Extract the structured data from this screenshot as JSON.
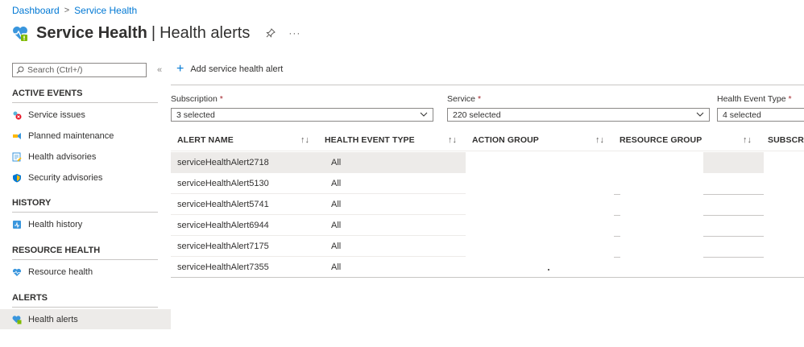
{
  "breadcrumb": {
    "items": [
      "Dashboard",
      "Service Health"
    ],
    "separator": ">"
  },
  "header": {
    "title": "Service Health",
    "divider": "|",
    "subtitle": "Health alerts",
    "more": "···"
  },
  "search": {
    "placeholder": "Search (Ctrl+/)"
  },
  "collapse_glyph": "«",
  "sidebar": {
    "sections": [
      {
        "heading": "ACTIVE EVENTS",
        "items": [
          {
            "label": "Service issues",
            "icon": "service-issues-icon"
          },
          {
            "label": "Planned maintenance",
            "icon": "planned-maintenance-icon"
          },
          {
            "label": "Health advisories",
            "icon": "health-advisories-icon"
          },
          {
            "label": "Security advisories",
            "icon": "security-advisories-icon"
          }
        ]
      },
      {
        "heading": "HISTORY",
        "items": [
          {
            "label": "Health history",
            "icon": "health-history-icon"
          }
        ]
      },
      {
        "heading": "RESOURCE HEALTH",
        "items": [
          {
            "label": "Resource health",
            "icon": "heart-icon"
          }
        ]
      },
      {
        "heading": "ALERTS",
        "items": [
          {
            "label": "Health alerts",
            "icon": "health-alerts-icon",
            "active": true
          }
        ]
      }
    ]
  },
  "toolbar": {
    "add_label": "Add service health alert"
  },
  "filters": {
    "subscription": {
      "label": "Subscription",
      "required": "*",
      "value": "3 selected"
    },
    "service": {
      "label": "Service",
      "required": "*",
      "value": "220 selected"
    },
    "event_type": {
      "label": "Health Event Type",
      "required": "*",
      "value": "4 selected"
    }
  },
  "table": {
    "columns": [
      "ALERT NAME",
      "HEALTH EVENT TYPE",
      "ACTION GROUP",
      "RESOURCE GROUP",
      "SUBSCRIP"
    ],
    "sort_glyph": "↑↓",
    "rows": [
      {
        "name": "serviceHealthAlert2718",
        "type": "All",
        "selected": true
      },
      {
        "name": "serviceHealthAlert5130",
        "type": "All"
      },
      {
        "name": "serviceHealthAlert5741",
        "type": "All"
      },
      {
        "name": "serviceHealthAlert6944",
        "type": "All"
      },
      {
        "name": "serviceHealthAlert7175",
        "type": "All"
      },
      {
        "name": "serviceHealthAlert7355",
        "type": "All"
      }
    ]
  },
  "colors": {
    "accent": "#0078d4",
    "required": "#a4262c",
    "selected_bg": "#edebe9"
  }
}
